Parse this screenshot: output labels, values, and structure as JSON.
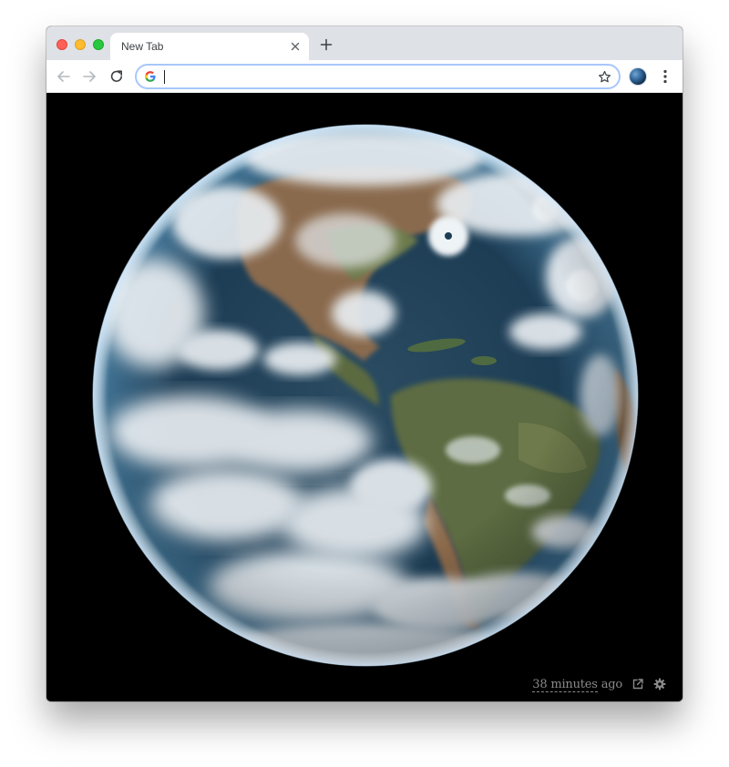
{
  "browser": {
    "tab": {
      "title": "New Tab"
    },
    "omnibox": {
      "value": "",
      "placeholder": ""
    }
  },
  "content": {
    "image_subject": "full-disk earth satellite image",
    "footer": {
      "time_value": "38 minutes",
      "time_suffix": " ago"
    }
  },
  "colors": {
    "tabstrip_bg": "#dee1e6",
    "page_bg": "#000000",
    "omnibox_focus": "#a8c7fa",
    "footer_text": "#8a8a8a"
  },
  "icons": [
    "back-arrow-icon",
    "forward-arrow-icon",
    "reload-icon",
    "google-g-icon",
    "bookmark-star-icon",
    "extension-earth-icon",
    "kebab-menu-icon",
    "tab-close-icon",
    "new-tab-plus-icon",
    "external-link-icon",
    "gear-icon"
  ]
}
